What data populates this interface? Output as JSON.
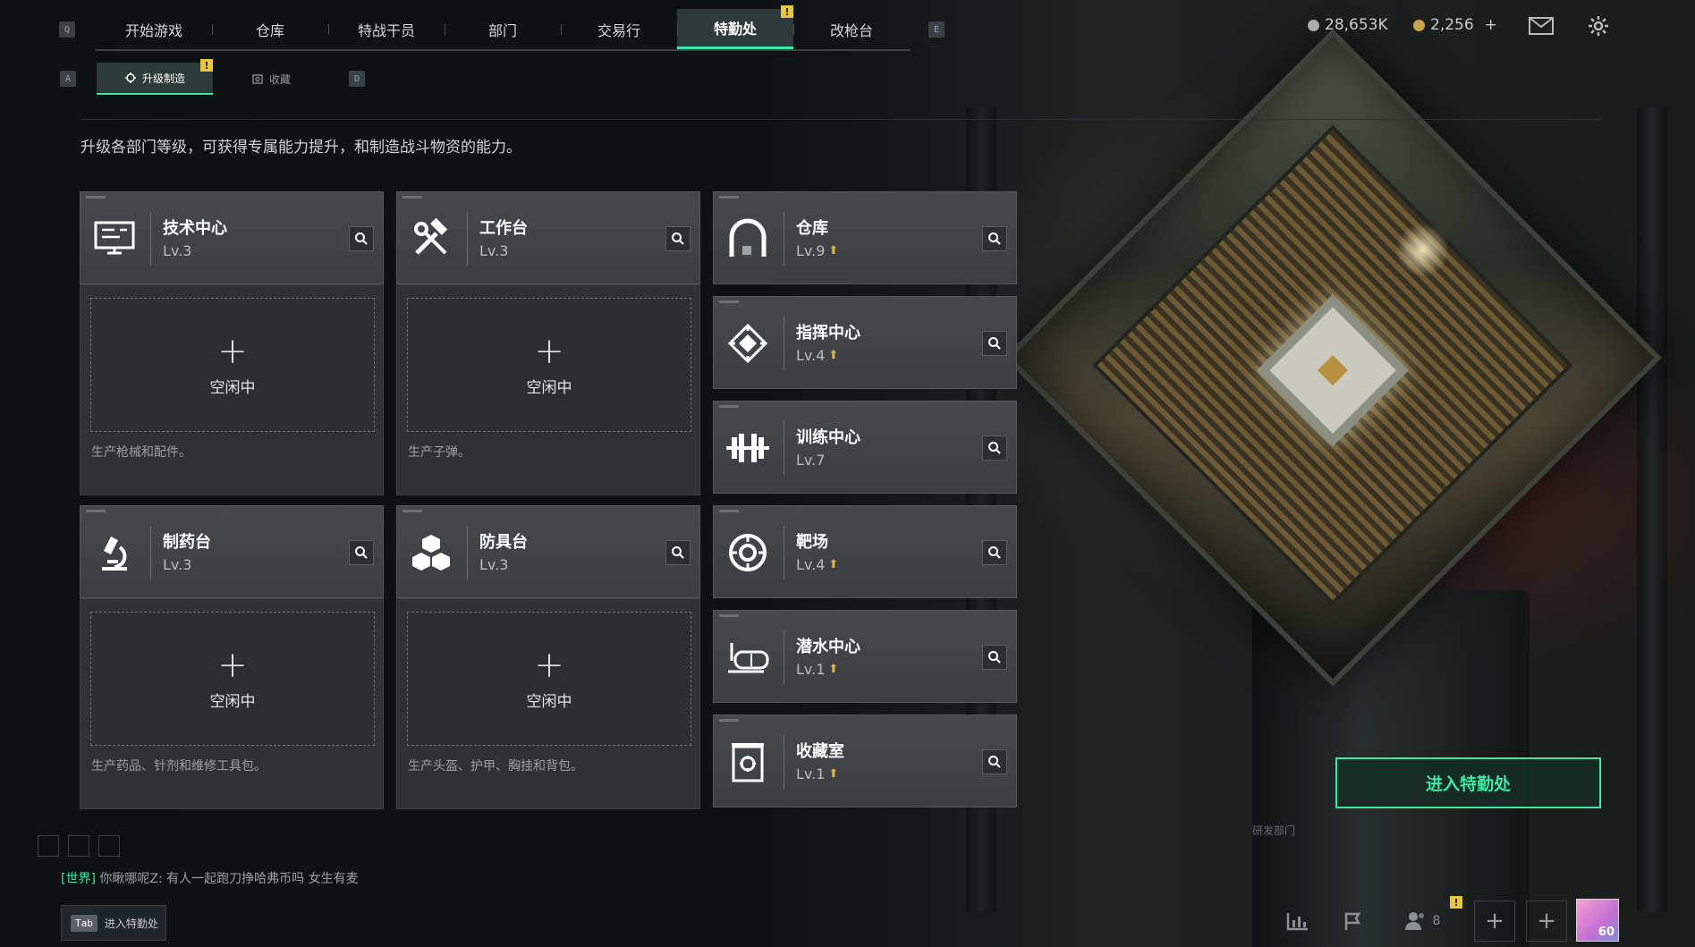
{
  "colors": {
    "accent": "#3de7a5",
    "badge": "#e8c640",
    "upgrade_arrow": "#e0b545",
    "silver_coin": "#a8adb0",
    "gold_coin": "#c9a24a"
  },
  "top_nav": {
    "left_key": "Q",
    "right_key": "E",
    "tabs": [
      {
        "label": "开始游戏"
      },
      {
        "label": "仓库"
      },
      {
        "label": "特战干员"
      },
      {
        "label": "部门"
      },
      {
        "label": "交易行"
      },
      {
        "label": "特勤处",
        "active": true,
        "badge": "!"
      },
      {
        "label": "改枪台"
      }
    ]
  },
  "sub_nav": {
    "left_key": "A",
    "right_key": "D",
    "tabs": [
      {
        "label": "升级制造",
        "active": true,
        "badge": "!"
      },
      {
        "label": "收藏"
      }
    ]
  },
  "currency": {
    "silver": "28,653K",
    "gold": "2,256",
    "gold_add": "+"
  },
  "intro_text": "升级各部门等级，可获得专属能力提升，和制造战斗物资的能力。",
  "production_depts": [
    {
      "name": "技术中心",
      "level": "Lv.3",
      "icon": "computer-icon",
      "slot_plus": "+",
      "slot_status": "空闲中",
      "desc": "生产枪械和配件。"
    },
    {
      "name": "工作台",
      "level": "Lv.3",
      "icon": "hammer-wrench-icon",
      "slot_plus": "+",
      "slot_status": "空闲中",
      "desc": "生产子弹。"
    },
    {
      "name": "制药台",
      "level": "Lv.3",
      "icon": "microscope-icon",
      "slot_plus": "+",
      "slot_status": "空闲中",
      "desc": "生产药品、针剂和维修工具包。"
    },
    {
      "name": "防具台",
      "level": "Lv.3",
      "icon": "boxes-icon",
      "slot_plus": "+",
      "slot_status": "空闲中",
      "desc": "生产头盔、护甲、胸挂和背包。"
    }
  ],
  "other_depts": [
    {
      "name": "仓库",
      "level": "Lv.9",
      "upgradable": true,
      "icon": "warehouse-arch-icon"
    },
    {
      "name": "指挥中心",
      "level": "Lv.4",
      "upgradable": true,
      "icon": "command-chip-icon"
    },
    {
      "name": "训练中心",
      "level": "Lv.7",
      "upgradable": false,
      "icon": "dumbbell-icon"
    },
    {
      "name": "靶场",
      "level": "Lv.4",
      "upgradable": true,
      "icon": "target-icon"
    },
    {
      "name": "潜水中心",
      "level": "Lv.1",
      "upgradable": true,
      "icon": "diving-mask-icon"
    },
    {
      "name": "收藏室",
      "level": "Lv.1",
      "upgradable": true,
      "icon": "collection-case-icon"
    }
  ],
  "enter_button": "进入特勤处",
  "scene_label": "研发部门",
  "chat": {
    "channel": "[世界]",
    "sender": "你瞅哪呢Z:",
    "message": "有人一起跑刀挣哈弗币吗 女生有麦"
  },
  "tab_hint": {
    "key": "Tab",
    "label": "进入特勤处"
  },
  "bottom_bar": {
    "friends_count": "8",
    "friends_badge": "!",
    "avatar_level": "60"
  }
}
